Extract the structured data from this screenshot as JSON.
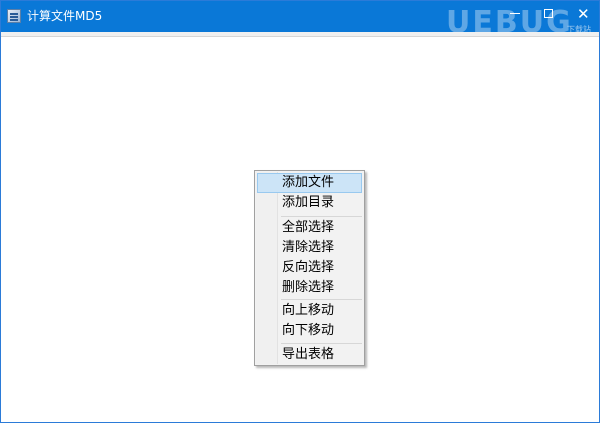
{
  "window": {
    "title": "计算文件MD5",
    "controls": {
      "minimize": "—",
      "maximize": "□",
      "close": "✕"
    },
    "watermark": "UEBUG",
    "watermark_sub": "下载站"
  },
  "context_menu": {
    "items": [
      {
        "label": "添加文件",
        "highlighted": true
      },
      {
        "label": "添加目录"
      },
      {
        "label": "全部选择"
      },
      {
        "label": "清除选择"
      },
      {
        "label": "反向选择"
      },
      {
        "label": "删除选择"
      },
      {
        "label": "向上移动"
      },
      {
        "label": "向下移动"
      },
      {
        "label": "导出表格"
      }
    ]
  },
  "colors": {
    "titlebar": "#0a78d7",
    "menu_highlight": "#cce4f7",
    "menu_highlight_border": "#99c9ef"
  }
}
